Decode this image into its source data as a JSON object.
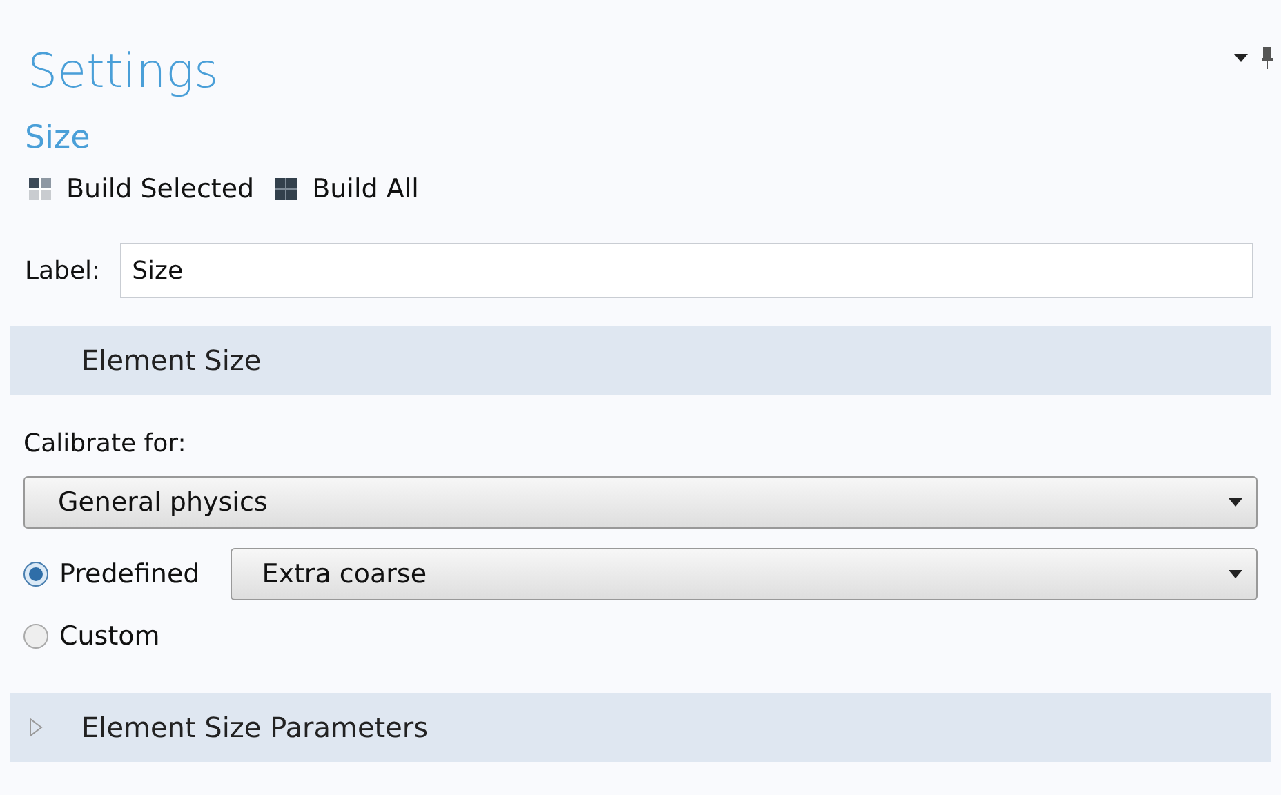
{
  "panel": {
    "title": "Settings",
    "subtitle": "Size"
  },
  "toolbar": [
    {
      "label": "Build Selected",
      "kind": "selected"
    },
    {
      "label": "Build All",
      "kind": "all"
    }
  ],
  "label_field": {
    "label": "Label:",
    "value": "Size"
  },
  "sections": [
    {
      "title": "Element Size",
      "expanded": true,
      "calibrate_label": "Calibrate for:",
      "calibrate_value": "General physics",
      "options": [
        {
          "label": "Predefined",
          "selected": true,
          "value": "Extra coarse"
        },
        {
          "label": "Custom",
          "selected": false
        }
      ]
    },
    {
      "title": "Element Size Parameters",
      "expanded": false
    }
  ]
}
